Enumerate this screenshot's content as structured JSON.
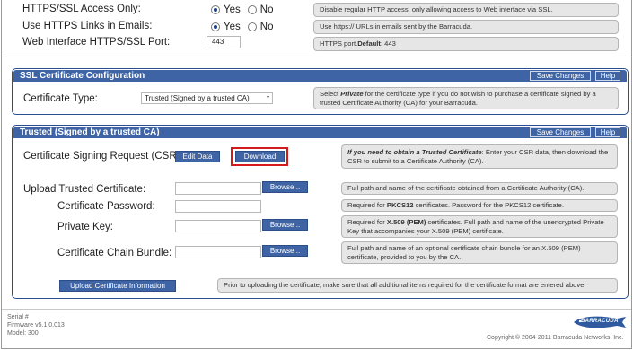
{
  "https": {
    "ssl_only_label": "HTTPS/SSL Access Only:",
    "ssl_only_yes": "Yes",
    "ssl_only_no": "No",
    "ssl_only_help": "Disable regular HTTP access, only allowing access to Web interface via SSL.",
    "links_label": "Use HTTPS Links in Emails:",
    "links_yes": "Yes",
    "links_no": "No",
    "links_help": "Use https:// URLs in emails sent by the Barracuda.",
    "port_label": "Web Interface HTTPS/SSL Port:",
    "port_value": "443",
    "port_help_prefix": "HTTPS port. ",
    "port_help_default": "Default",
    "port_help_suffix": ": 443"
  },
  "ssl_config": {
    "title": "SSL Certificate Configuration",
    "save_label": "Save Changes",
    "help_label": "Help",
    "cert_type_label": "Certificate Type:",
    "cert_type_value": "Trusted (Signed by a trusted CA)",
    "cert_type_help_pre": "Select ",
    "cert_type_help_em": "Private",
    "cert_type_help_post": " for the certificate type if you do not wish to purchase a certificate signed by a trusted Certificate Authority (CA) for your Barracuda."
  },
  "trusted": {
    "title": "Trusted (Signed by a trusted CA)",
    "save_label": "Save Changes",
    "help_label": "Help",
    "csr_label": "Certificate Signing Request (CSR):",
    "edit_data_label": "Edit Data",
    "download_label": "Download",
    "csr_help_em": "If you need to obtain a Trusted Certificate",
    "csr_help_rest": ": Enter your CSR data, then download the CSR to submit to a Certificate Authority (CA).",
    "upload_label": "Upload Trusted Certificate:",
    "browse_label": "Browse...",
    "upload_help": "Full path and name of the certificate obtained from a Certificate Authority (CA).",
    "password_label": "Certificate Password:",
    "password_help_pre": "Required for ",
    "password_help_em": "PKCS12",
    "password_help_post": " certificates. Password for the PKCS12 certificate.",
    "private_key_label": "Private Key:",
    "private_key_help_pre": "Required for ",
    "private_key_help_em": "X.509 (PEM)",
    "private_key_help_post": " certificates. Full path and name of the unencrypted Private Key that accompanies your X.509 (PEM) certificate.",
    "chain_label": "Certificate Chain Bundle:",
    "chain_help": "Full path and name of an optional certificate chain bundle for an X.509 (PEM) certificate, provided to you by the CA.",
    "upload_info_label": "Upload Certificate Information",
    "upload_info_help": "Prior to uploading the certificate, make sure that all additional items required for the certificate format are entered above."
  },
  "footer": {
    "serial": "Serial #",
    "firmware": "Firmware v5.1.0.013",
    "model": "Model: 300",
    "copyright": "Copyright © 2004-2011 Barracuda Networks, Inc.",
    "logo_text": "BARRACUDA"
  },
  "colors": {
    "header_blue": "#3e64a5",
    "highlight_red": "#d41a1a"
  }
}
